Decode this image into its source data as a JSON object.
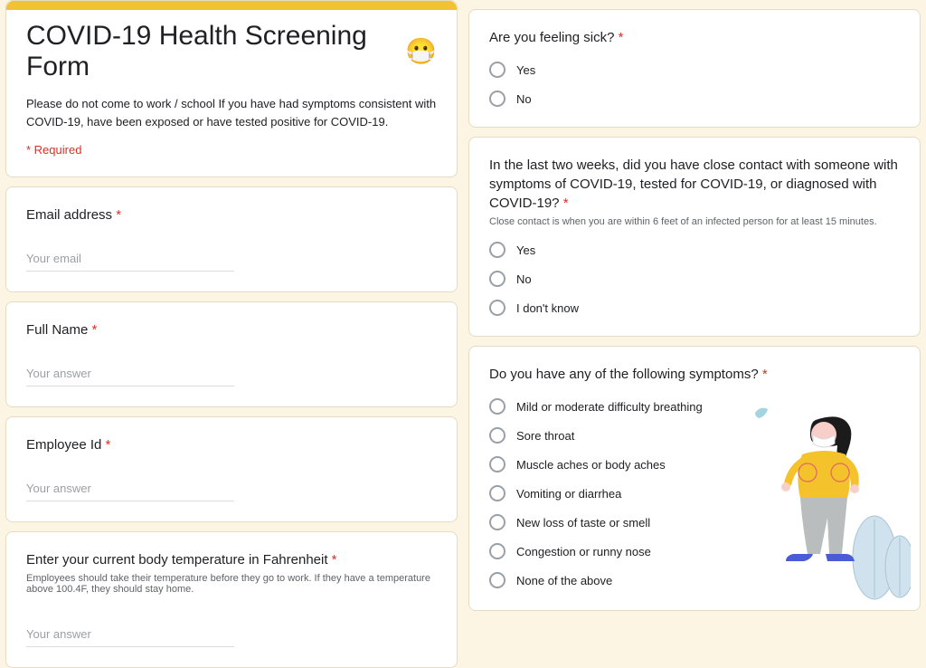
{
  "header": {
    "title": "COVID-19 Health Screening Form",
    "emoji": "😷",
    "description": "Please do not come to work / school If you have had symptoms consistent with COVID-19, have been exposed or have tested positive for COVID-19.",
    "required_note": "* Required"
  },
  "left_questions": [
    {
      "title": "Email address",
      "required": true,
      "placeholder": "Your email",
      "help": ""
    },
    {
      "title": "Full Name",
      "required": true,
      "placeholder": "Your answer",
      "help": ""
    },
    {
      "title": "Employee Id",
      "required": true,
      "placeholder": "Your answer",
      "help": ""
    },
    {
      "title": "Enter your current body temperature in Fahrenheit",
      "required": true,
      "placeholder": "Your answer",
      "help": "Employees should take their temperature before they go to work. If they have a temperature above 100.4F, they should stay home."
    }
  ],
  "right_questions": [
    {
      "title": "Are you feeling sick?",
      "required": true,
      "help": "",
      "options": [
        "Yes",
        "No"
      ]
    },
    {
      "title": "In the last two weeks, did you have close contact with someone with symptoms of COVID-19, tested for COVID-19, or diagnosed with COVID-19?",
      "required": true,
      "help": "Close contact is when you are within 6 feet of an infected person for at least 15 minutes.",
      "options": [
        "Yes",
        "No",
        "I don't know"
      ]
    },
    {
      "title": "Do you have any of the following symptoms?",
      "required": true,
      "help": "",
      "options": [
        "Mild or moderate difficulty breathing",
        "Sore throat",
        "Muscle aches or body aches",
        "Vomiting or diarrhea",
        "New loss of taste or smell",
        "Congestion or runny nose",
        "None of the above"
      ]
    }
  ]
}
